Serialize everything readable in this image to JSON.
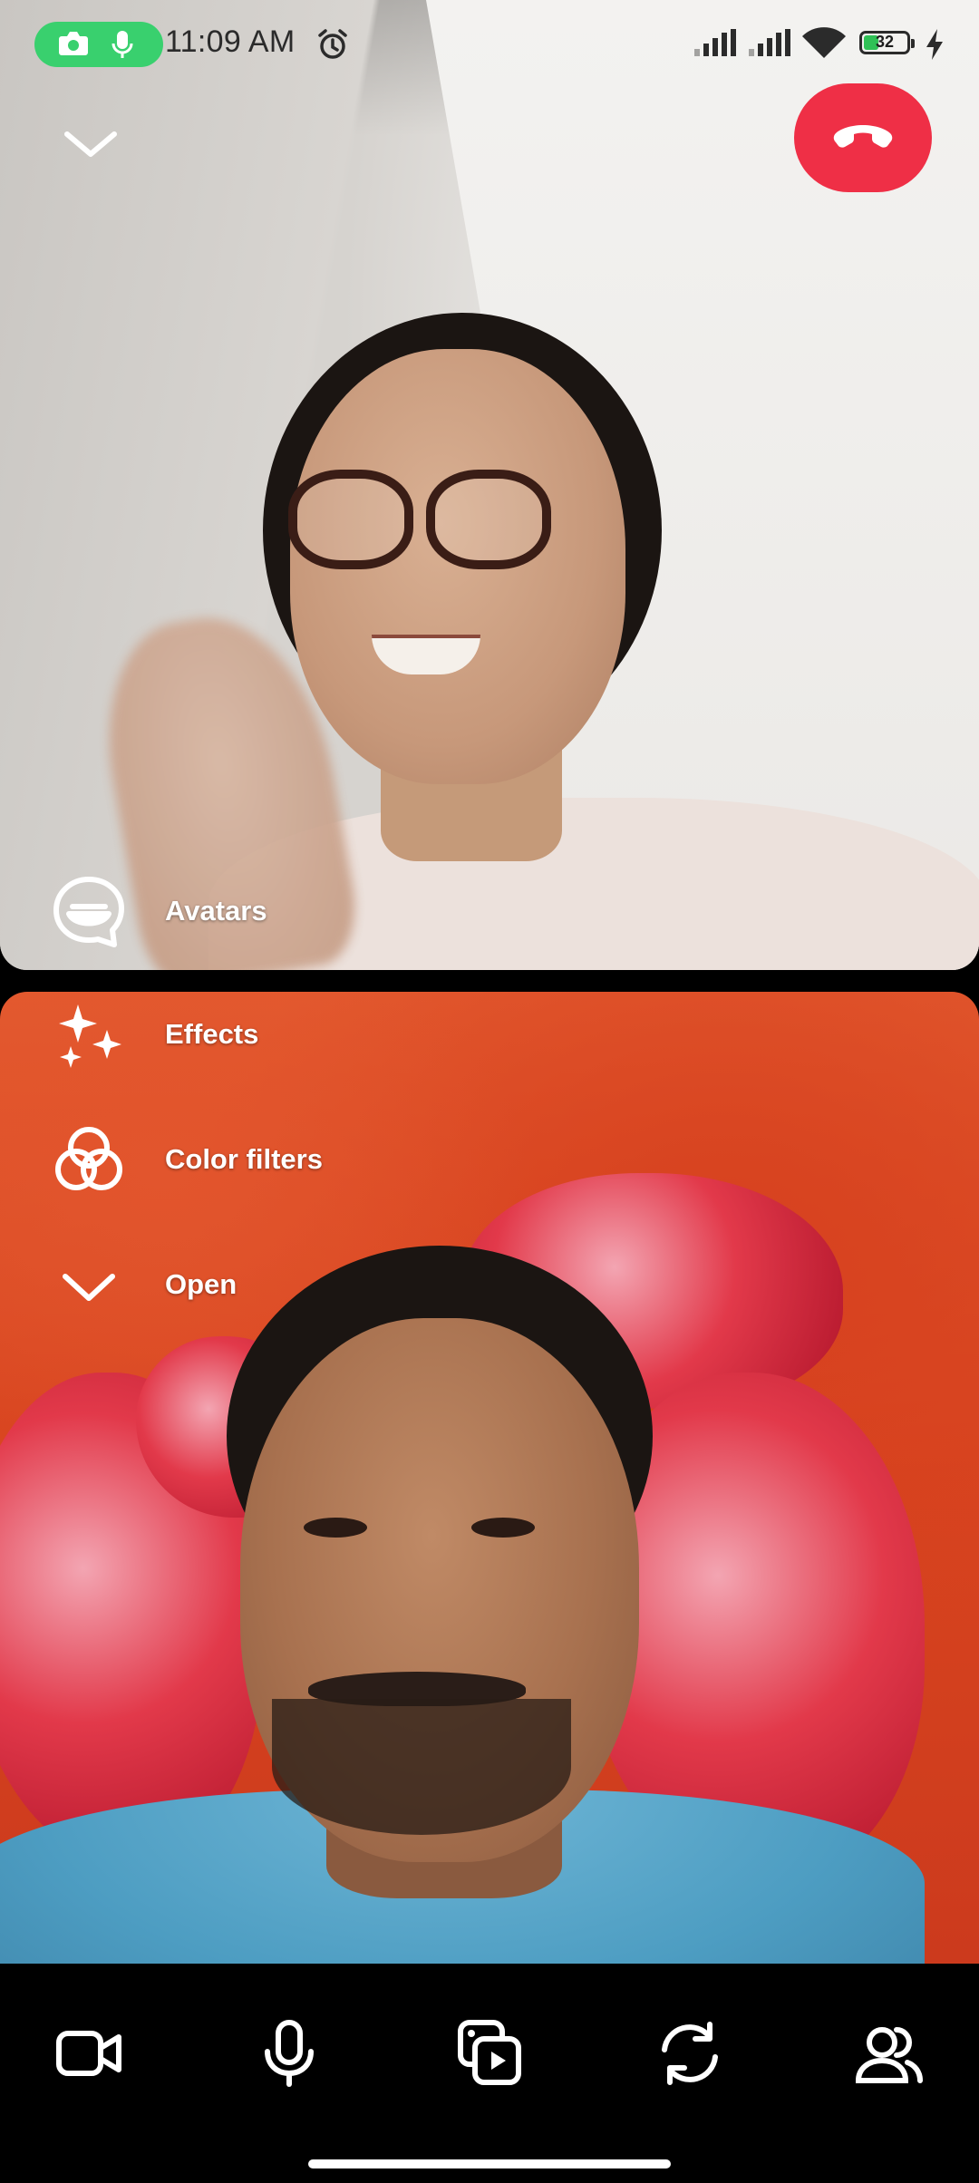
{
  "status_bar": {
    "time": "11:09 AM",
    "battery": "32"
  },
  "menu": {
    "avatars": "Avatars",
    "effects": "Effects",
    "color_filters": "Color filters",
    "open": "Open"
  },
  "colors": {
    "end_call": "#ef2f46",
    "recording_pill": "#39d06e"
  },
  "icons": {
    "collapse": "chevron-down-icon",
    "end_call": "phone-hangup-icon",
    "avatars": "avatar-icon",
    "effects": "sparkle-icon",
    "color_filters": "color-filter-icon",
    "open": "chevron-down-icon",
    "camera": "video-camera-icon",
    "mic": "microphone-icon",
    "share": "share-media-icon",
    "flip": "flip-camera-icon",
    "people": "people-icon"
  }
}
